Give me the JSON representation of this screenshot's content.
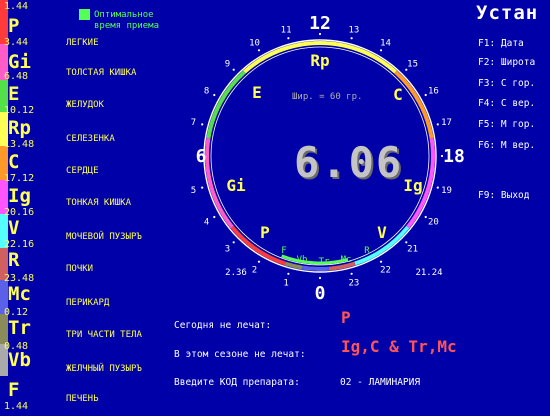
{
  "legend": {
    "line1": "Оптимальное",
    "line2": "время приема"
  },
  "organs": [
    {
      "time": "1.44",
      "code": "P",
      "name": "ЛЕГКИЕ",
      "color": "#ff3a3a"
    },
    {
      "time": "3.44",
      "code": "Gi",
      "name": "ТОЛСТАЯ КИШКА",
      "color": "#ff5cc8"
    },
    {
      "time": "6.48",
      "code": "E",
      "name": "ЖЕЛУДОК",
      "color": "#55e04a"
    },
    {
      "time": "10.12",
      "code": "Rp",
      "name": "СЕЛЕЗЕНКА",
      "color": "#ffff55"
    },
    {
      "time": "13.48",
      "code": "C",
      "name": "СЕРДЦЕ",
      "color": "#ff9a2a"
    },
    {
      "time": "17.12",
      "code": "Ig",
      "name": "ТОНКАЯ КИШКА",
      "color": "#ff55ff"
    },
    {
      "time": "20.16",
      "code": "V",
      "name": "МОЧЕВОЙ ПУЗЫРЪ",
      "color": "#55ffff"
    },
    {
      "time": "22.16",
      "code": "R",
      "name": "ПОЧКИ",
      "color": "#d06060"
    },
    {
      "time": "23.48",
      "code": "Mc",
      "name": "ПЕРИКАРД",
      "color": "#5a60e8"
    },
    {
      "time": "0.12",
      "code": "Tr",
      "name": "ТРИ ЧАСТИ ТЕЛА",
      "color": "#8a8a5a"
    },
    {
      "time": "0.48",
      "code": "Vb",
      "name": "ЖЕЛЧНЫЙ ПУЗЫРЪ",
      "color": "#aaaaaa"
    },
    {
      "time": "1.44",
      "code": "F",
      "name": "ПЕЧЕНЬ",
      "color": ""
    }
  ],
  "menu": {
    "title": "Устан",
    "items": [
      "F1: Дата",
      "F2: Широта",
      "F3: С гор.",
      "F4: С вер.",
      "F5: М гор.",
      "F6: М вер.",
      "F9: Выход"
    ]
  },
  "dial": {
    "main_hours": [
      "12",
      "18",
      "0",
      "6"
    ],
    "hours": [
      "11",
      "13",
      "10",
      "14",
      "9",
      "15",
      "8",
      "16",
      "7",
      "17",
      "5",
      "19",
      "4",
      "20",
      "3",
      "21",
      "2",
      "22",
      "1",
      "23"
    ],
    "outer_organs": [
      "Rp",
      "E",
      "C",
      "Gi",
      "Ig",
      "P",
      "V"
    ],
    "inner_organs": [
      "F",
      "Vb",
      "Tr",
      "Mc",
      "R"
    ],
    "time_labels": [
      "2.36",
      "21.24"
    ],
    "latitude": "Шир. = 60 гр.",
    "center_value": "6.06"
  },
  "info": {
    "today_label": "Сегодня не лечат:",
    "today_value": "P",
    "season_label": "В этом сезоне не лечат:",
    "season_value": "Ig,C & Tr,Mc",
    "drug_label": "Введите КОД препарата:",
    "drug_value": "02 - ЛАМИНАРИЯ"
  }
}
